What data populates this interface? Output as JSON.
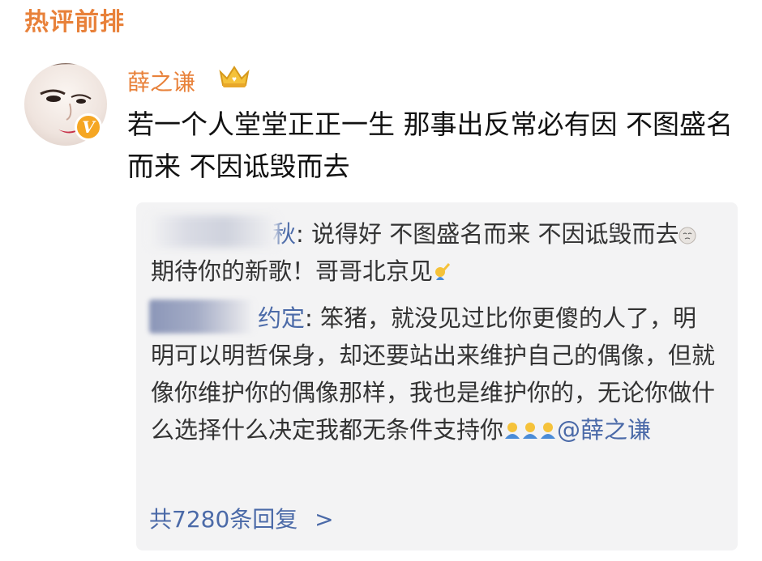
{
  "section_title": "热评前排",
  "comment": {
    "username": "薛之谦",
    "text": "若一个人堂堂正正一生 那事出反常必有因 不图盛名而来 不因诋毁而去"
  },
  "replies": [
    {
      "author_suffix": "秋",
      "separator": ": ",
      "text_before_emoji": "说得好 不图盛名而来 不因诋毁而去",
      "text_after_emoji": "期待你的新歌！哥哥北京见"
    },
    {
      "author_suffix": "约定",
      "separator": ": ",
      "text": "笨猪，就没见过比你更傻的人了，明明可以明哲保身，却还要站出来维护自己的偶像，但就像你维护你的偶像那样，我也是维护你的，无论你做什么选择什么决定我都无条件支持你",
      "mention": "@薛之谦"
    }
  ],
  "reply_count_label": "共7280条回复",
  "reply_count_chevron": ">",
  "colors": {
    "accent_orange": "#e8813a",
    "link_blue": "#4b6aa8",
    "reply_bg": "#f3f3f4"
  },
  "icons": [
    "crown-icon",
    "verified-badge-icon",
    "cry-emoji-icon",
    "cheer-emoji-icon",
    "hug-emoji-icon",
    "chevron-right-icon"
  ]
}
